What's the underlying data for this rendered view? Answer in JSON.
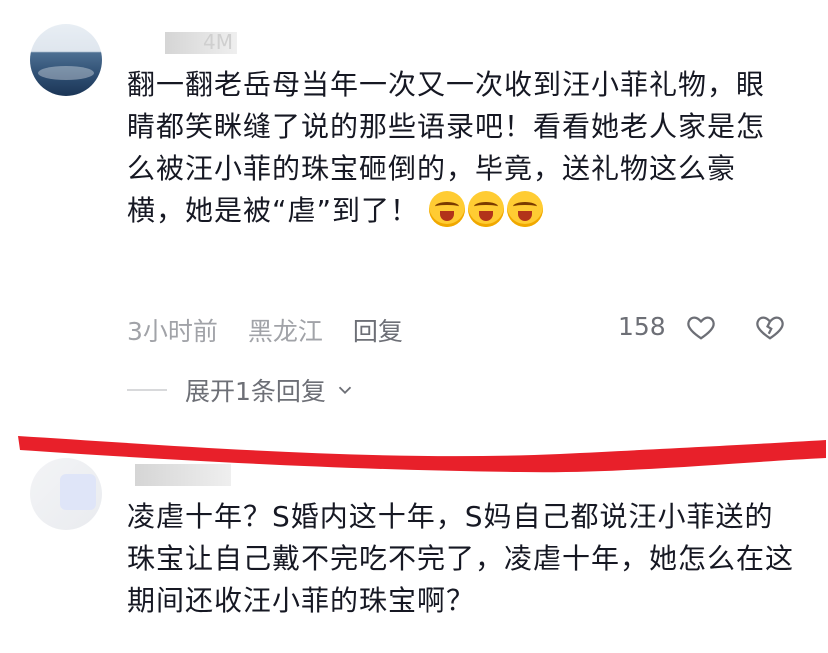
{
  "comments": [
    {
      "username_suffix": "4M",
      "text": "翻一翻老岳母当年一次又一次收到汪小菲礼物，眼睛都笑眯缝了说的那些语录吧！看看她老人家是怎么被汪小菲的珠宝砸倒的，毕竟，送礼物这么豪横，她是被“虐”到了！",
      "emoji": [
        "crying-laughing-face",
        "crying-laughing-face",
        "crying-laughing-face"
      ],
      "time": "3小时前",
      "location": "黑龙江",
      "reply_label": "回复",
      "like_count": "158",
      "expand_label": "展开1条回复"
    },
    {
      "text": "凌虐十年？S婚内这十年，S妈自己都说汪小菲送的珠宝让自己戴不完吃不完了，凌虐十年，她怎么在这期间还收汪小菲的珠宝啊？"
    }
  ],
  "colors": {
    "text": "#161823",
    "meta": "#a1a3a8",
    "action": "#6d6f76",
    "annotation": "#e8202a"
  }
}
